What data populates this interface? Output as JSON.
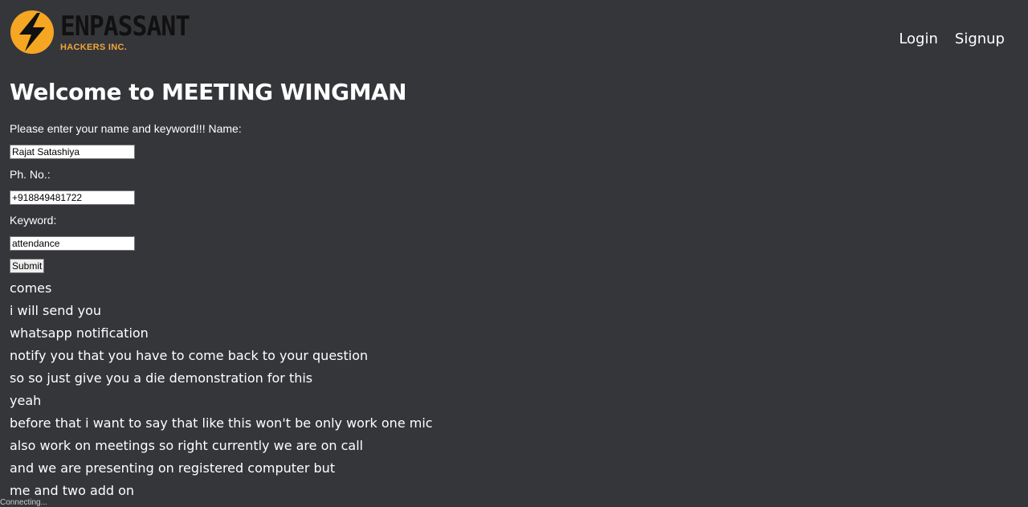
{
  "brand": {
    "name": "ENPASSANT",
    "subtitle": "HACKERS INC.",
    "accent_color": "#f5a623"
  },
  "nav": {
    "login": "Login",
    "signup": "Signup"
  },
  "page": {
    "title": "Welcome to MEETING WINGMAN"
  },
  "form": {
    "intro_label": "Please enter your name and keyword!!! Name:",
    "name_value": "Rajat Satashiya",
    "phone_label": "Ph. No.:",
    "phone_value": "+918849481722",
    "keyword_label": "Keyword:",
    "keyword_value": "attendance",
    "submit_label": "Submit"
  },
  "transcript": [
    "comes",
    "i will send you",
    "whatsapp notification",
    "notify you that you have to come back to your question",
    "so so just give you a die demonstration for this",
    "yeah",
    "before that i want to say that like this won't be only work one mic",
    "also work on meetings so right currently we are on call",
    "and we are presenting on registered computer but",
    "me and two add on"
  ],
  "status": "Connecting..."
}
